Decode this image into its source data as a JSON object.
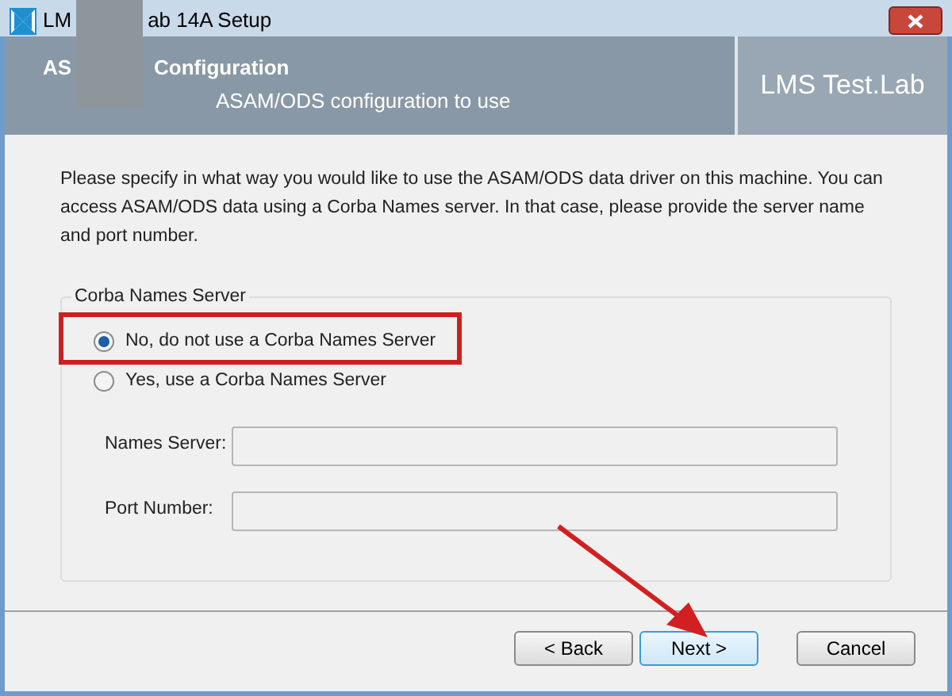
{
  "window": {
    "title_parts": [
      "LM",
      "ab 14A Setup"
    ]
  },
  "header": {
    "title_parts": [
      "AS",
      "Configuration"
    ],
    "subtitle": "ASAM/ODS configuration to use",
    "brand": "LMS Test.Lab"
  },
  "description": "Please specify in what way you would like to use the ASAM/ODS data driver on this machine. You can access ASAM/ODS data using a Corba Names server. In that case, please provide the server name and port number.",
  "group": {
    "title": "Corba Names Server",
    "options": [
      {
        "label": "No, do not use a Corba Names Server",
        "selected": true
      },
      {
        "label": "Yes, use a Corba Names Server",
        "selected": false
      }
    ],
    "fields": [
      {
        "label": "Names Server:"
      },
      {
        "label": "Port Number:"
      }
    ]
  },
  "buttons": [
    {
      "label": "< Back",
      "focused": false
    },
    {
      "label": "Next >",
      "focused": true
    },
    {
      "label": "Cancel",
      "focused": false
    }
  ]
}
